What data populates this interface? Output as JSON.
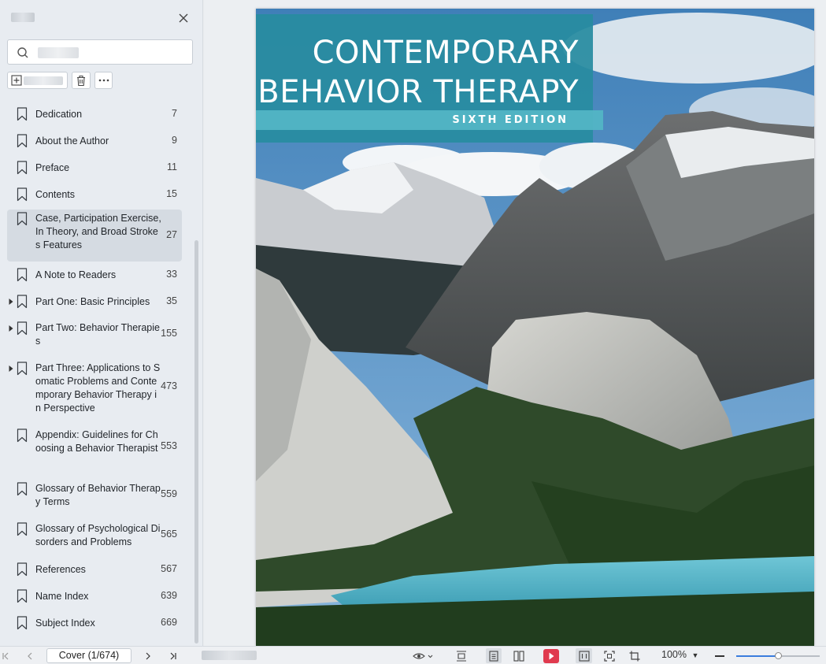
{
  "sidebar": {
    "search": {
      "placeholder": "",
      "value": ""
    },
    "toc": [
      {
        "label": "Dedication",
        "page": "7",
        "expandable": false,
        "active": false
      },
      {
        "label": "About the Author",
        "page": "9",
        "expandable": false,
        "active": false
      },
      {
        "label": "Preface",
        "page": "11",
        "expandable": false,
        "active": false
      },
      {
        "label": "Contents",
        "page": "15",
        "expandable": false,
        "active": false
      },
      {
        "label": "Case, Participation Exercise, In Theory, and Broad Strokes Features",
        "page": "27",
        "expandable": false,
        "active": true
      },
      {
        "label": "A Note to Readers",
        "page": "33",
        "expandable": false,
        "active": false
      },
      {
        "label": "Part One: Basic Principles",
        "page": "35",
        "expandable": true,
        "active": false
      },
      {
        "label": "Part Two: Behavior Therapies",
        "page": "155",
        "expandable": true,
        "active": false
      },
      {
        "label": "Part Three: Applications to Somatic Problems and Contemporary Behavior Therapy in Perspective",
        "page": "473",
        "expandable": true,
        "active": false
      },
      {
        "label": "Appendix: Guidelines for Choosing a Behavior Therapist",
        "page": "553",
        "expandable": false,
        "active": false
      },
      {
        "label": "Glossary of Behavior Therapy Terms",
        "page": "559",
        "expandable": false,
        "active": false
      },
      {
        "label": "Glossary of Psychological Disorders and Problems",
        "page": "565",
        "expandable": false,
        "active": false
      },
      {
        "label": "References",
        "page": "567",
        "expandable": false,
        "active": false
      },
      {
        "label": "Name Index",
        "page": "639",
        "expandable": false,
        "active": false
      },
      {
        "label": "Subject Index",
        "page": "669",
        "expandable": false,
        "active": false
      }
    ]
  },
  "cover": {
    "title_line1": "CONTEMPORARY",
    "title_line2": "BEHAVIOR THERAPY",
    "edition": "SIXTH EDITION"
  },
  "statusbar": {
    "page_indicator": "Cover (1/674)",
    "zoom": "100%",
    "zoom_fraction": 0.5
  },
  "colors": {
    "accent": "#3b7ddd",
    "title_teal": "#288ca0",
    "edition_teal": "#52b5c5",
    "play_red": "#e03a4e"
  }
}
